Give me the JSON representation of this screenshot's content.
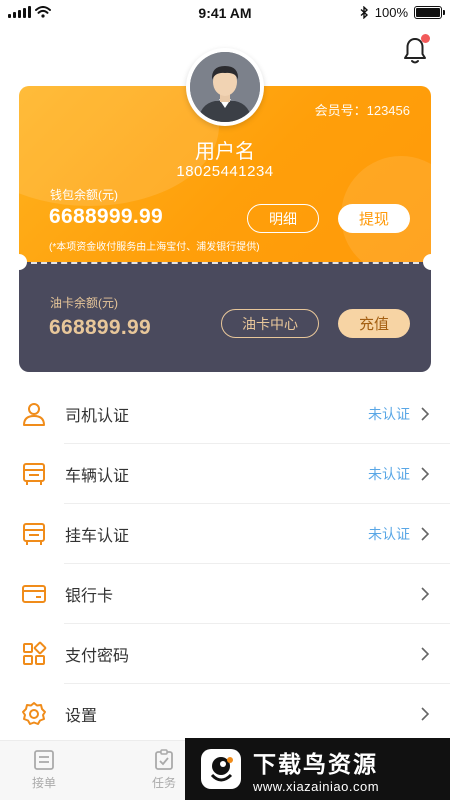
{
  "status_bar": {
    "time": "9:41 AM",
    "battery": "100%",
    "battery_level": 1.0
  },
  "header": {
    "bell_icon": "bell-icon",
    "has_notification": true
  },
  "wallet_card": {
    "member_no": "会员号：123456",
    "username": "用户名",
    "phone": "18025441234",
    "wallet_label": "钱包余额(元)",
    "wallet_amount": "6688999.99",
    "note": "(*本项资金收付服务由上海宝付、浦发银行提供)",
    "detail_button": "明细",
    "withdraw_button": "提现",
    "fuel_label": "油卡余额(元)",
    "fuel_amount": "668899.99",
    "fuel_center_button": "油卡中心",
    "recharge_button": "充值"
  },
  "menu": [
    {
      "label": "司机认证",
      "status": "未认证",
      "icon": "driver-icon"
    },
    {
      "label": "车辆认证",
      "status": "未认证",
      "icon": "truck-icon"
    },
    {
      "label": "挂车认证",
      "status": "未认证",
      "icon": "trailer-icon"
    },
    {
      "label": "银行卡",
      "status": "",
      "icon": "bank-card-icon"
    },
    {
      "label": "支付密码",
      "status": "",
      "icon": "grid-icon"
    },
    {
      "label": "设置",
      "status": "",
      "icon": "gear-icon"
    }
  ],
  "tabbar": [
    {
      "label": "接单",
      "icon": "order-icon"
    },
    {
      "label": "任务",
      "icon": "task-icon"
    }
  ],
  "watermark": {
    "title": "下载鸟资源",
    "url": "www.xiazainiao.com"
  },
  "colors": {
    "accent": "#ff9f0a",
    "fuel_card": "#4a4a5d",
    "gold": "#e8c79a",
    "status_blue": "#5aa7e6"
  }
}
